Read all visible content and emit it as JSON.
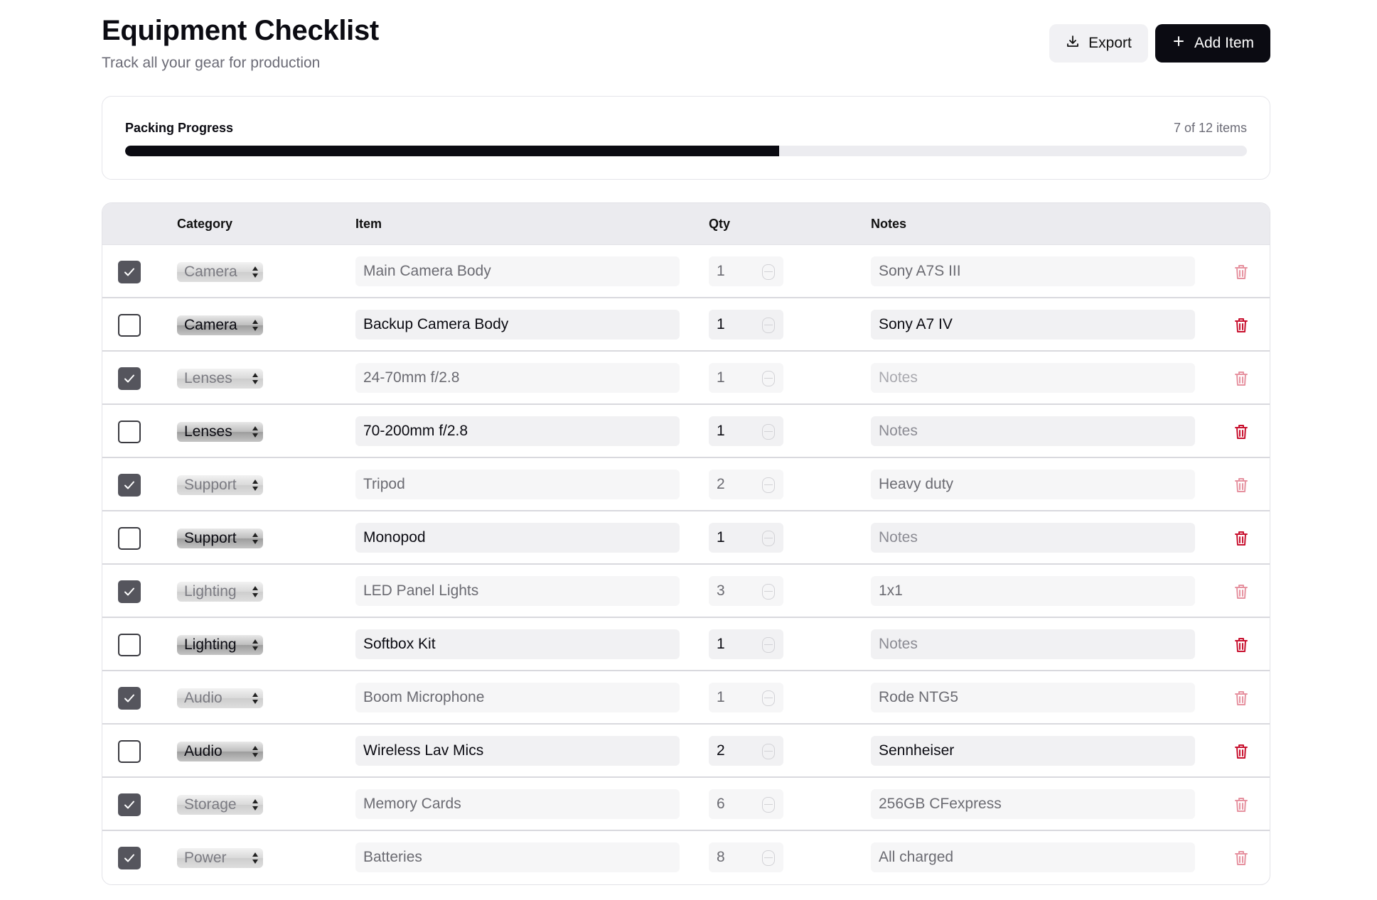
{
  "header": {
    "title": "Equipment Checklist",
    "subtitle": "Track all your gear for production",
    "export_label": "Export",
    "add_label": "Add Item"
  },
  "progress": {
    "label": "Packing Progress",
    "count_text": "7 of 12 items",
    "fraction": 0.5833
  },
  "table": {
    "columns": [
      "Category",
      "Item",
      "Qty",
      "Notes"
    ],
    "notes_placeholder": "Notes",
    "rows": [
      {
        "checked": true,
        "category": "Camera",
        "item": "Main Camera Body",
        "qty": "1",
        "notes": "Sony A7S III"
      },
      {
        "checked": false,
        "category": "Camera",
        "item": "Backup Camera Body",
        "qty": "1",
        "notes": "Sony A7 IV"
      },
      {
        "checked": true,
        "category": "Lenses",
        "item": "24-70mm f/2.8",
        "qty": "1",
        "notes": ""
      },
      {
        "checked": false,
        "category": "Lenses",
        "item": "70-200mm f/2.8",
        "qty": "1",
        "notes": ""
      },
      {
        "checked": true,
        "category": "Support",
        "item": "Tripod",
        "qty": "2",
        "notes": "Heavy duty"
      },
      {
        "checked": false,
        "category": "Support",
        "item": "Monopod",
        "qty": "1",
        "notes": ""
      },
      {
        "checked": true,
        "category": "Lighting",
        "item": "LED Panel Lights",
        "qty": "3",
        "notes": "1x1"
      },
      {
        "checked": false,
        "category": "Lighting",
        "item": "Softbox Kit",
        "qty": "1",
        "notes": ""
      },
      {
        "checked": true,
        "category": "Audio",
        "item": "Boom Microphone",
        "qty": "1",
        "notes": "Rode NTG5"
      },
      {
        "checked": false,
        "category": "Audio",
        "item": "Wireless Lav Mics",
        "qty": "2",
        "notes": "Sennheiser"
      },
      {
        "checked": true,
        "category": "Storage",
        "item": "Memory Cards",
        "qty": "6",
        "notes": "256GB CFexpress"
      },
      {
        "checked": true,
        "category": "Power",
        "item": "Batteries",
        "qty": "8",
        "notes": "All charged"
      }
    ]
  },
  "colors": {
    "accent": "#0b0b12",
    "delete": "#c8102e",
    "checked_box": "#55555d"
  },
  "icons": {
    "export": "download-icon",
    "add": "plus-icon",
    "delete": "trash-icon",
    "check": "check-icon"
  }
}
